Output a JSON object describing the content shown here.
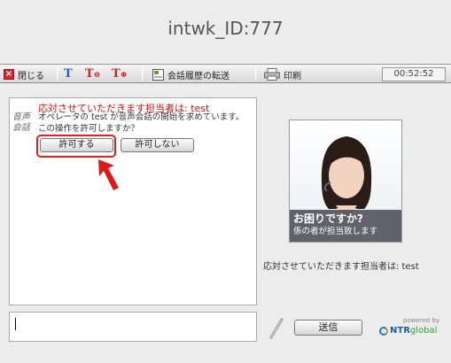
{
  "window": {
    "title": "intwk_ID:777"
  },
  "toolbar": {
    "close_label": "閉じる",
    "transfer_label": "会話履歴の転送",
    "print_label": "印刷",
    "timer": "00:52:52"
  },
  "chat": {
    "side_label": "音声会話",
    "agent_line": "応対させていただきます担当者は: test",
    "message": "オペレータの test が音声会話の開始を求めています。この操作を許可しますか？",
    "allow_button": "許可する",
    "deny_button": "許可しない"
  },
  "agent_panel": {
    "caption_line1": "お困りですか?",
    "caption_line2": "係の者が担当致します",
    "info": "応対させていただきます担当者は: test"
  },
  "composer": {
    "input_value": "",
    "send_button": "送信"
  },
  "branding": {
    "powered_by": "powered by",
    "logo_main": "NTR",
    "logo_sub": "global"
  },
  "colors": {
    "highlight": "#e02020",
    "agent_text": "#cc1111"
  }
}
